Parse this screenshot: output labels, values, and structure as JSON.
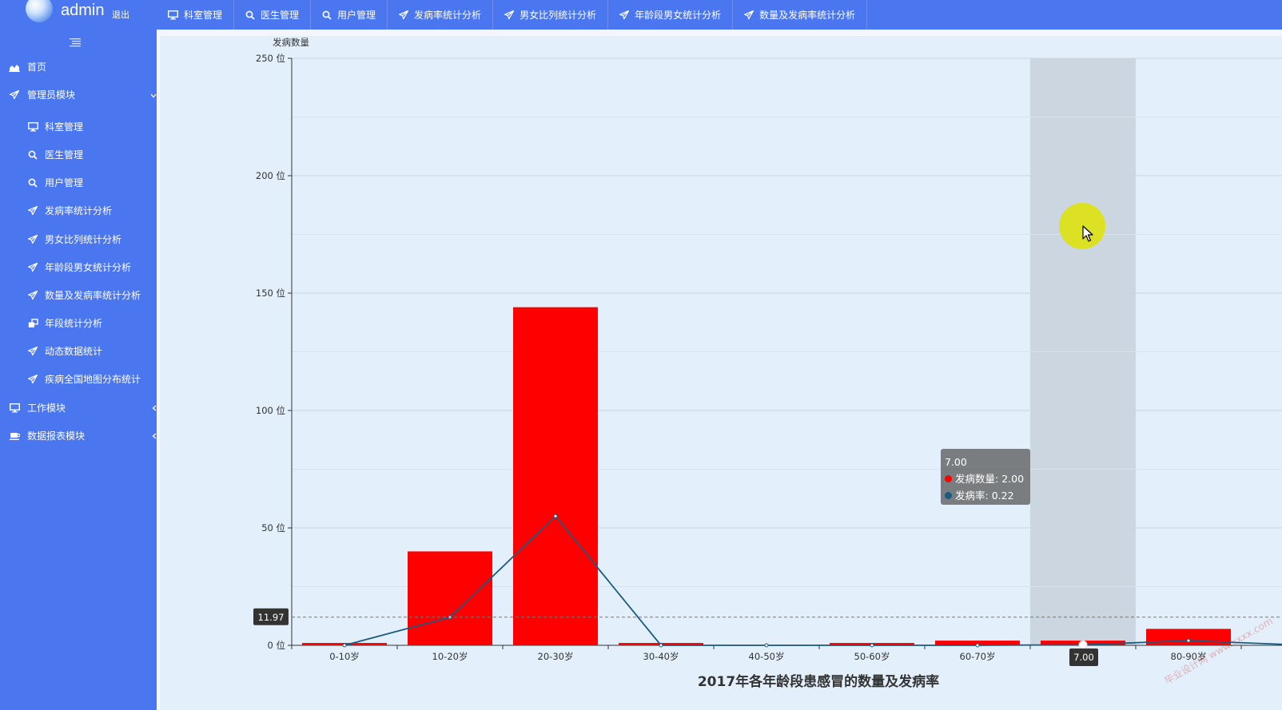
{
  "header": {
    "username": "admin",
    "logout": "退出"
  },
  "topnav": [
    {
      "label": "科室管理",
      "icon": "monitor-icon"
    },
    {
      "label": "医生管理",
      "icon": "search-icon"
    },
    {
      "label": "用户管理",
      "icon": "search-icon"
    },
    {
      "label": "发病率统计分析",
      "icon": "rocket-icon"
    },
    {
      "label": "男女比列统计分析",
      "icon": "rocket-icon"
    },
    {
      "label": "年龄段男女统计分析",
      "icon": "rocket-icon"
    },
    {
      "label": "数量及发病率统计分析",
      "icon": "rocket-icon"
    }
  ],
  "sidebar": {
    "items": [
      {
        "label": "首页",
        "icon": "area-chart-icon",
        "level": 0
      },
      {
        "label": "管理员模块",
        "icon": "rocket-icon",
        "level": 0,
        "expanded": true
      },
      {
        "label": "科室管理",
        "icon": "monitor-icon",
        "level": 1
      },
      {
        "label": "医生管理",
        "icon": "search-icon",
        "level": 1
      },
      {
        "label": "用户管理",
        "icon": "search-icon",
        "level": 1
      },
      {
        "label": "发病率统计分析",
        "icon": "rocket-icon",
        "level": 1
      },
      {
        "label": "男女比列统计分析",
        "icon": "rocket-icon",
        "level": 1
      },
      {
        "label": "年龄段男女统计分析",
        "icon": "rocket-icon",
        "level": 1
      },
      {
        "label": "数量及发病率统计分析",
        "icon": "rocket-icon",
        "level": 1
      },
      {
        "label": "年段统计分析",
        "icon": "clone-icon",
        "level": 1
      },
      {
        "label": "动态数据统计",
        "icon": "rocket-icon",
        "level": 1
      },
      {
        "label": "疾病全国地图分布统计",
        "icon": "rocket-icon",
        "level": 1
      },
      {
        "label": "工作模块",
        "icon": "monitor-icon",
        "level": 0,
        "expanded": false
      },
      {
        "label": "数据报表模块",
        "icon": "coffee-icon",
        "level": 0,
        "expanded": false
      }
    ]
  },
  "chart_data": {
    "type": "bar",
    "title": "2017年各年龄段患感冒的数量及发病率",
    "ylabel": "发病数量",
    "y_tick_suffix": " 位",
    "ylim": [
      0,
      250
    ],
    "yticks": [
      0,
      50,
      100,
      150,
      200,
      250
    ],
    "categories": [
      "0-10岁",
      "10-20岁",
      "20-30岁",
      "30-40岁",
      "40-50岁",
      "50-60岁",
      "60-70岁",
      "7.00",
      "80-90岁"
    ],
    "series": [
      {
        "name": "发病数量",
        "type": "bar",
        "color": "#ff0000",
        "values": [
          1,
          40,
          144,
          1,
          0,
          1,
          2,
          2,
          7
        ]
      },
      {
        "name": "发病率",
        "type": "line",
        "color": "#1a5a80",
        "values": [
          0,
          11.97,
          55,
          0,
          0,
          0,
          0,
          0.22,
          2
        ]
      }
    ],
    "highlight_category": "7.00",
    "crosshair_y_label": "11.97",
    "tooltip": {
      "title": "7.00",
      "rows": [
        {
          "name": "发病数量",
          "value": "2.00",
          "color": "#ff0000"
        },
        {
          "name": "发病率",
          "value": "0.22",
          "color": "#1a5a80"
        }
      ]
    },
    "watermark": "毕业设计网 www.xxxx.com"
  }
}
